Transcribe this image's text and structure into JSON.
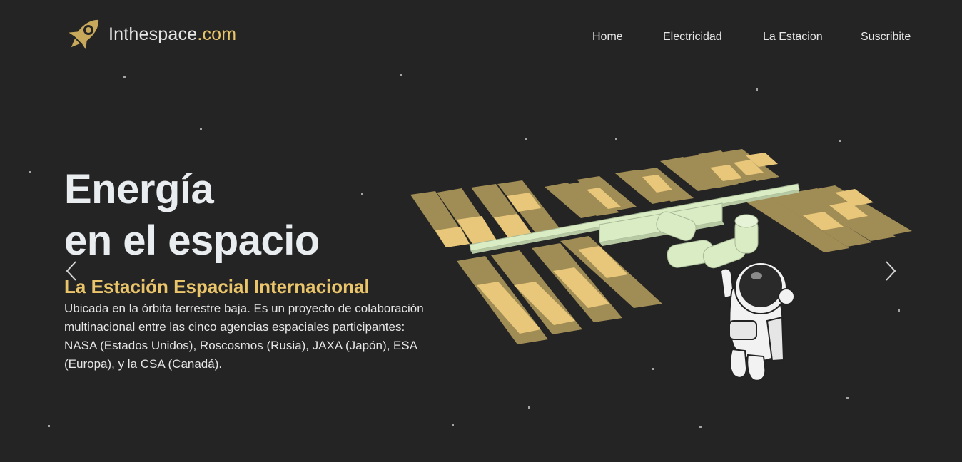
{
  "brand": {
    "name": "Inthespace",
    "tld": ".com",
    "logo_icon": "rocket-icon"
  },
  "nav": {
    "items": [
      "Home",
      "Electricidad",
      "La Estacion",
      "Suscribite"
    ]
  },
  "hero": {
    "title_line1": "Energía",
    "title_line2": "en el espacio",
    "subtitle": "La Estación Espacial Internacional",
    "description": "Ubicada en la órbita terrestre baja. Es un proyecto de colaboración multinacional entre las cinco agencias espaciales participantes: NASA (Estados Unidos), Roscosmos (Rusia), JAXA (Japón), ESA (Europa), y la CSA (Canadá)."
  },
  "carousel": {
    "prev_icon": "chevron-left-icon",
    "next_icon": "chevron-right-icon"
  },
  "illustration": "space-station-astronaut-illustration",
  "colors": {
    "background": "#242424",
    "accent": "#e9c46a",
    "text": "#e6e6e6",
    "panel_dark": "#a08c55",
    "panel_light": "#e8c67a",
    "module": "#d9ecc4"
  }
}
